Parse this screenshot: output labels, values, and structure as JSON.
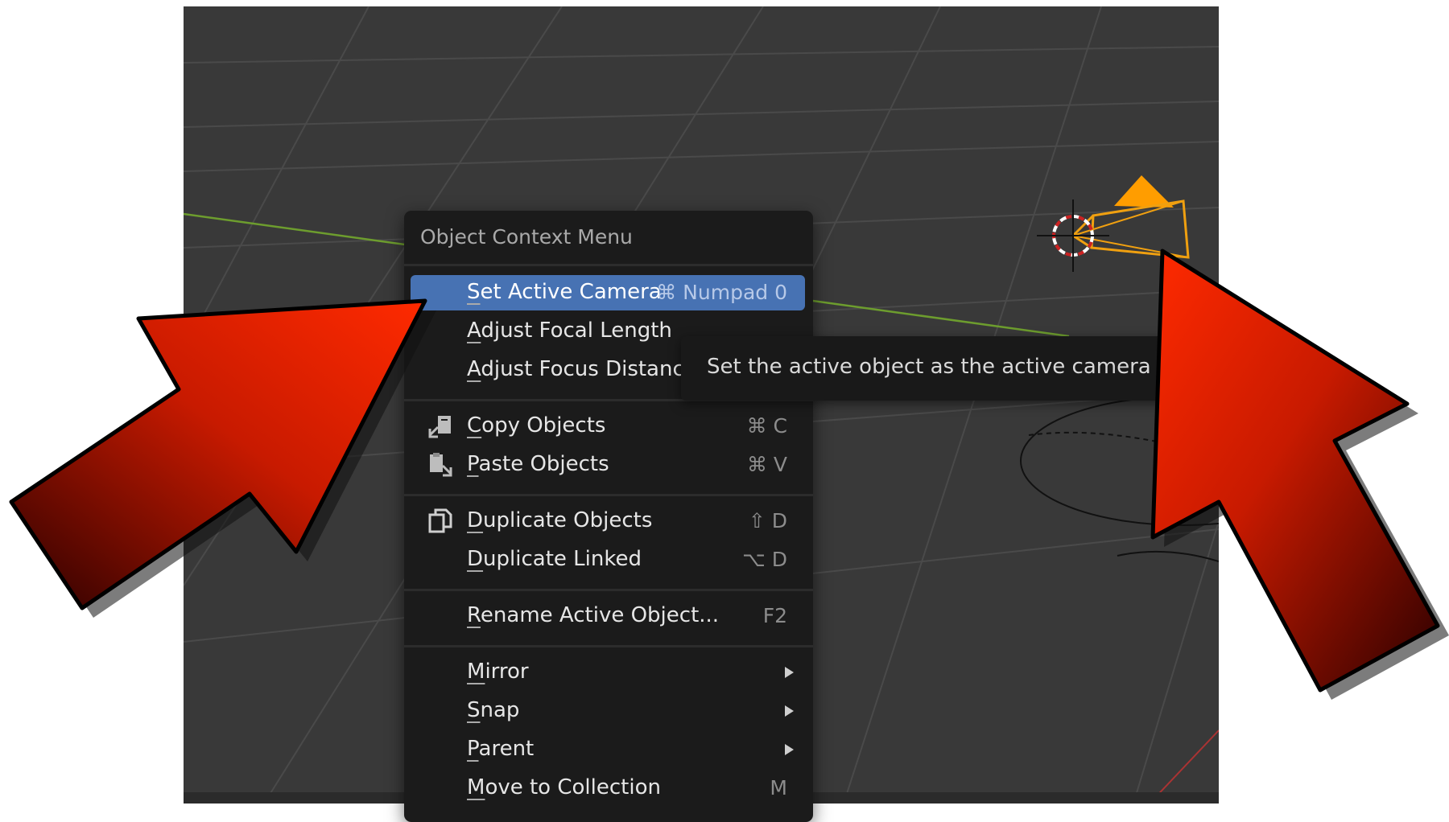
{
  "colors": {
    "viewport_bg": "#393939",
    "grid_line": "#4a4a4a",
    "x_axis": "#6d9d2e",
    "camera": "#f0a010",
    "menu_bg": "#1b1b1b",
    "highlight": "#4772b3",
    "arrow": "#ff2200"
  },
  "context_menu": {
    "title": "Object Context Menu",
    "items": [
      {
        "label": "Set Active Camera",
        "shortcut": "⌘ Numpad 0",
        "icon": "",
        "submenu": false,
        "active": true
      },
      {
        "label": "Adjust Focal Length",
        "shortcut": "",
        "icon": "",
        "submenu": false
      },
      {
        "label": "Adjust Focus Distance",
        "shortcut": "",
        "icon": "",
        "submenu": false
      },
      {
        "label": "Copy Objects",
        "shortcut": "⌘ C",
        "icon": "copy-objects-icon",
        "submenu": false
      },
      {
        "label": "Paste Objects",
        "shortcut": "⌘ V",
        "icon": "paste-objects-icon",
        "submenu": false
      },
      {
        "label": "Duplicate Objects",
        "shortcut": "⇧ D",
        "icon": "duplicate-icon",
        "submenu": false
      },
      {
        "label": "Duplicate Linked",
        "shortcut": "⌥ D",
        "icon": "",
        "submenu": false
      },
      {
        "label": "Rename Active Object...",
        "shortcut": "F2",
        "icon": "",
        "submenu": false
      },
      {
        "label": "Mirror",
        "shortcut": "",
        "icon": "",
        "submenu": true
      },
      {
        "label": "Snap",
        "shortcut": "",
        "icon": "",
        "submenu": true
      },
      {
        "label": "Parent",
        "shortcut": "",
        "icon": "",
        "submenu": true
      },
      {
        "label": "Move to Collection",
        "shortcut": "M",
        "icon": "",
        "submenu": false
      }
    ]
  },
  "tooltip": {
    "text": "Set the active object as the active camera for t"
  }
}
